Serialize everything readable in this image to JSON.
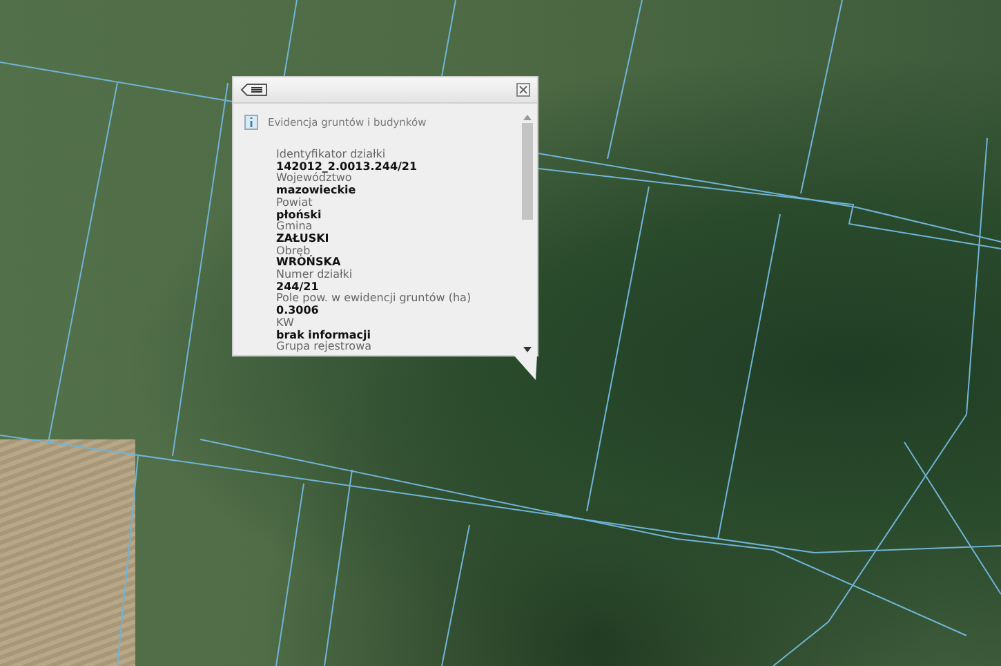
{
  "popup": {
    "title": "Evidencja gruntów i budynków",
    "fields": [
      {
        "label": "Identyfikator działki",
        "value": "142012_2.0013.244/21"
      },
      {
        "label": "Województwo",
        "value": "mazowieckie"
      },
      {
        "label": "Powiat",
        "value": "płoński"
      },
      {
        "label": "Gmina",
        "value": "ZAŁUSKI"
      },
      {
        "label": "Obręb",
        "value": "WROŃSKA"
      },
      {
        "label": "Numer działki",
        "value": "244/21"
      },
      {
        "label": "Pole pow. w ewidencji gruntów (ha)",
        "value": "0.3006"
      },
      {
        "label": "KW",
        "value": "brak informacji"
      },
      {
        "label": "Grupa rejestrowa"
      }
    ]
  }
}
